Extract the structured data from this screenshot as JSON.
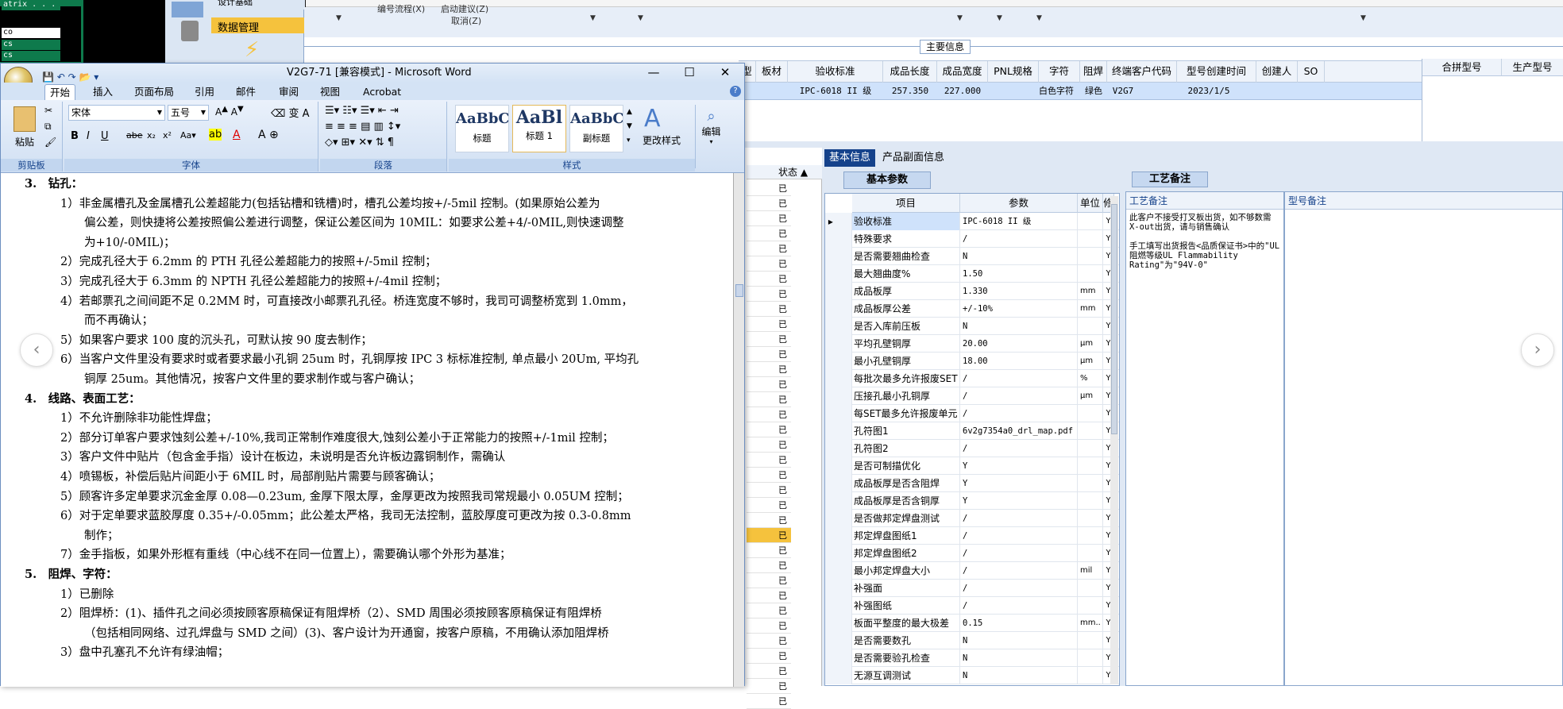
{
  "bg": {
    "left_rows": [
      "atrix . . .",
      "co",
      "cs",
      "cs"
    ],
    "nav_items": [
      "设计基础",
      "数据管理"
    ],
    "filter_labels": [
      "编号流程(X)",
      "启动建议(Z)",
      "取消(Z)"
    ],
    "main_info": "主要信息",
    "grid_headers": [
      "型",
      "板材",
      "验收标准",
      "成品长度",
      "成品宽度",
      "PNL规格",
      "字符",
      "阻焊",
      "终端客户代码",
      "型号创建时间",
      "创建人",
      "SO"
    ],
    "grid_row": [
      "",
      "",
      "IPC-6018 II 级",
      "257.350",
      "227.000",
      "",
      "白色字符",
      "绿色",
      "V2G7",
      "2023/1/5",
      "",
      ""
    ],
    "right_headers": [
      "合拼型号",
      "生产型号"
    ],
    "status_header": "状态",
    "status_items": [
      "已审核",
      "已审核",
      "已审核",
      "已审核",
      "已审核",
      "已审核",
      "已审核",
      "已审核",
      "已审核",
      "已审核",
      "已审核",
      "已审核",
      "已审核",
      "已审核",
      "已审核",
      "已审核",
      "已审核",
      "已审核",
      "已审核",
      "已审核",
      "已审核",
      "已审核",
      "已审核",
      "已审核",
      "已审核",
      "已审核",
      "已审核",
      "已审核",
      "已审核",
      "已审核",
      "已审核",
      "已审核",
      "已审核",
      "已审核",
      "已审核"
    ],
    "tabs": [
      "基本信息",
      "产品副面信息"
    ],
    "subtab": "基本参数",
    "param_headers": [
      "项目",
      "参数",
      "单位",
      "修"
    ],
    "params": [
      {
        "n": "验收标准",
        "v": "IPC-6018 II 级",
        "u": "",
        "f": "Y"
      },
      {
        "n": "特殊要求",
        "v": "/",
        "u": "",
        "f": "Y"
      },
      {
        "n": "是否需要翘曲检查",
        "v": "N",
        "u": "",
        "f": "Y"
      },
      {
        "n": "最大翘曲度%",
        "v": "1.50",
        "u": "",
        "f": "Y"
      },
      {
        "n": "成品板厚",
        "v": "1.330",
        "u": "mm",
        "f": "Y"
      },
      {
        "n": "成品板厚公差",
        "v": "+/-10%",
        "u": "mm",
        "f": "Y"
      },
      {
        "n": "是否入库前压板",
        "v": "N",
        "u": "",
        "f": "Y"
      },
      {
        "n": "平均孔壁铜厚",
        "v": "20.00",
        "u": "μm",
        "f": "Y"
      },
      {
        "n": "最小孔壁铜厚",
        "v": "18.00",
        "u": "μm",
        "f": "Y"
      },
      {
        "n": "每批次最多允许报废SET",
        "v": "/",
        "u": "%",
        "f": "Y"
      },
      {
        "n": "压接孔最小孔铜厚",
        "v": "/",
        "u": "μm",
        "f": "Y"
      },
      {
        "n": "每SET最多允许报废单元",
        "v": "/",
        "u": "",
        "f": "Y"
      },
      {
        "n": "孔符图1",
        "v": "6v2g7354a0_drl_map.pdf",
        "u": "",
        "f": "Y"
      },
      {
        "n": "孔符图2",
        "v": "/",
        "u": "",
        "f": "Y"
      },
      {
        "n": "是否可制描优化",
        "v": "Y",
        "u": "",
        "f": "Y"
      },
      {
        "n": "成品板厚是否含阻焊",
        "v": "Y",
        "u": "",
        "f": "Y"
      },
      {
        "n": "成品板厚是否含铜厚",
        "v": "Y",
        "u": "",
        "f": "Y"
      },
      {
        "n": "是否做邦定焊盘测试",
        "v": "/",
        "u": "",
        "f": "Y"
      },
      {
        "n": "邦定焊盘图纸1",
        "v": "/",
        "u": "",
        "f": "Y"
      },
      {
        "n": "邦定焊盘图纸2",
        "v": "/",
        "u": "",
        "f": "Y"
      },
      {
        "n": "最小邦定焊盘大小",
        "v": "/",
        "u": "mil",
        "f": "Y"
      },
      {
        "n": "补强面",
        "v": "/",
        "u": "",
        "f": "Y"
      },
      {
        "n": "补强图纸",
        "v": "/",
        "u": "",
        "f": "Y"
      },
      {
        "n": "板面平整度的最大极差",
        "v": "0.15",
        "u": "mm..",
        "f": "Y"
      },
      {
        "n": "是否需要数孔",
        "v": "N",
        "u": "",
        "f": "Y"
      },
      {
        "n": "是否需要验孔检查",
        "v": "N",
        "u": "",
        "f": "Y"
      },
      {
        "n": "无源互调测试",
        "v": "N",
        "u": "",
        "f": "Y"
      }
    ],
    "craft_tab": "工艺备注",
    "craft_header": "工艺备注",
    "craft_text": "此客户不接受打叉板出货，如不够数需X-out出货，请与销售确认\n\n手工填写出货报告<品质保证书>中的\"UL阻燃等级UL Flammability Rating\"为\"94V-0\"",
    "model_header": "型号备注"
  },
  "word": {
    "title": "V2G7-71 [兼容模式] - Microsoft Word",
    "tabs": [
      "开始",
      "插入",
      "页面布局",
      "引用",
      "邮件",
      "审阅",
      "视图",
      "Acrobat"
    ],
    "paste": "粘贴",
    "clipboard": "剪贴板",
    "font_name": "宋体",
    "font_size": "五号",
    "font_group": "字体",
    "para_group": "段落",
    "style_group": "样式",
    "styles": [
      {
        "preview": "AaBbC",
        "label": "标题"
      },
      {
        "preview": "AaBl",
        "label": "标题 1"
      },
      {
        "preview": "AaBbC",
        "label": "副标题"
      }
    ],
    "change_style": "更改样式",
    "edit": "编辑",
    "lines": [
      {
        "cls": "h1",
        "t": "3.　钻孔："
      },
      {
        "cls": "l2",
        "t": "1）非金属槽孔及金属槽孔公差超能力(包括钻槽和铣槽)时，槽孔公差均按+/-5mil 控制。(如果原始公差为"
      },
      {
        "cls": "cont",
        "t": "偏公差，则快捷将公差按照偏公差进行调整，保证公差区间为 10MIL：如要求公差+4/-0MIL,则快速调整"
      },
      {
        "cls": "cont",
        "t": "为+10/-0MIL)；"
      },
      {
        "cls": "l2",
        "t": "2）完成孔径大于 6.2mm 的 PTH 孔径公差超能力的按照+/-5mil 控制；"
      },
      {
        "cls": "l2",
        "t": "3）完成孔径大于 6.3mm 的 NPTH 孔径公差超能力的按照+/-4mil 控制；"
      },
      {
        "cls": "l2",
        "t": "4）若邮票孔之间间距不足 0.2MM 时，可直接改小邮票孔孔径。桥连宽度不够时，我司可调整桥宽到 1.0mm，"
      },
      {
        "cls": "cont",
        "t": "而不再确认；"
      },
      {
        "cls": "l2",
        "t": "5）如果客户要求 100 度的沉头孔，可默认按 90 度去制作；"
      },
      {
        "cls": "l2",
        "t": "6）当客户文件里没有要求时或者要求最小孔铜 25um 时，孔铜厚按 IPC 3 标标准控制, 单点最小 20Um, 平均孔"
      },
      {
        "cls": "cont",
        "t": "铜厚 25um。其他情况，按客户文件里的要求制作或与客户确认；"
      },
      {
        "cls": "h1",
        "t": "4.　线路、表面工艺："
      },
      {
        "cls": "l2",
        "t": "1）不允许删除非功能性焊盘；"
      },
      {
        "cls": "l2",
        "t": "2）部分订单客户要求蚀刻公差+/-10%,我司正常制作难度很大,蚀刻公差小于正常能力的按照+/-1mil 控制；"
      },
      {
        "cls": "l2",
        "t": "3）客户文件中贴片（包含金手指）设计在板边，未说明是否允许板边露铜制作，需确认"
      },
      {
        "cls": "l2",
        "t": "4）喷锡板，补偿后贴片间距小于 6MIL 时，局部削贴片需要与顾客确认；"
      },
      {
        "cls": "l2",
        "t": "5）顾客许多定单要求沉金金厚 0.08—0.23um, 金厚下限太厚，金厚更改为按照我司常规最小 0.05UM 控制；"
      },
      {
        "cls": "l2",
        "t": "6）对于定单要求蓝胶厚度 0.35+/-0.05mm；此公差太严格，我司无法控制，蓝胶厚度可更改为按 0.3-0.8mm"
      },
      {
        "cls": "cont",
        "t": "制作；"
      },
      {
        "cls": "l2",
        "t": "7）金手指板，如果外形框有重线（中心线不在同一位置上），需要确认哪个外形为基准；"
      },
      {
        "cls": "h1",
        "t": "5.　阻焊、字符："
      },
      {
        "cls": "l2",
        "t": "1）已删除"
      },
      {
        "cls": "l2",
        "t": "2）阻焊桥：(1)、插件孔之间必须按顾客原稿保证有阻焊桥（2）、SMD 周围必须按顾客原稿保证有阻焊桥"
      },
      {
        "cls": "cont",
        "t": "（包括相同网络、过孔焊盘与 SMD 之间）(3)、客户设计为开通窗，按客户原稿，不用确认添加阻焊桥"
      },
      {
        "cls": "l2",
        "t": "3）盘中孔塞孔不允许有绿油帽；"
      }
    ]
  }
}
